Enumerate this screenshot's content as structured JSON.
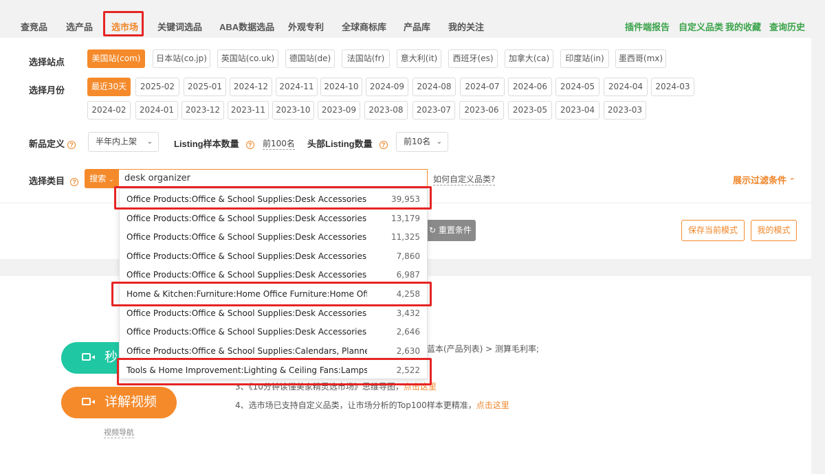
{
  "nav": {
    "tabs": [
      "查竞品",
      "选产品",
      "选市场",
      "关键词选品",
      "ABA数据选品",
      "外观专利",
      "全球商标库",
      "产品库",
      "我的关注"
    ],
    "active_tab": "选市场",
    "right_links": [
      "插件端报告",
      "自定义品类",
      "我的收藏",
      "查询历史"
    ]
  },
  "filters": {
    "site_label": "选择站点",
    "sites": [
      "美国站(com)",
      "日本站(co.jp)",
      "英国站(co.uk)",
      "德国站(de)",
      "法国站(fr)",
      "意大利(it)",
      "西班牙(es)",
      "加拿大(ca)",
      "印度站(in)",
      "墨西哥(mx)"
    ],
    "selected_site": "美国站(com)",
    "month_label": "选择月份",
    "months_row1": [
      "最近30天",
      "2025-02",
      "2025-01",
      "2024-12",
      "2024-11",
      "2024-10",
      "2024-09",
      "2024-08",
      "2024-07",
      "2024-06",
      "2024-05",
      "2024-04",
      "2024-03"
    ],
    "months_row2": [
      "2024-02",
      "2024-01",
      "2023-12",
      "2023-11",
      "2023-10",
      "2023-09",
      "2023-08",
      "2023-07",
      "2023-06",
      "2023-05",
      "2023-04",
      "2023-03"
    ],
    "selected_month": "最近30天",
    "new_def_label": "新品定义",
    "new_def_value": "半年内上架",
    "listing_sample_label": "Listing样本数量",
    "listing_sample_value": "前100名",
    "top_listing_label": "头部Listing数量",
    "top_listing_value": "前10名",
    "category_label": "选择类目",
    "search_btn": "搜索",
    "search_value": "desk organizer",
    "howto": "如何自定义品类?",
    "expand": "展示过滤条件"
  },
  "actions": {
    "reset": "重置条件",
    "save_mode": "保存当前模式",
    "my_mode": "我的模式"
  },
  "dropdown": [
    {
      "name": "Office Products:Office & School Supplies:Desk Accessories &...",
      "count": "39,953",
      "highlighted": true
    },
    {
      "name": "Office Products:Office & School Supplies:Desk Accessories &...",
      "count": "13,179",
      "highlighted": false
    },
    {
      "name": "Office Products:Office & School Supplies:Desk Accessories &...",
      "count": "11,325",
      "highlighted": false
    },
    {
      "name": "Office Products:Office & School Supplies:Desk Accessories &...",
      "count": "7,860",
      "highlighted": false
    },
    {
      "name": "Office Products:Office & School Supplies:Desk Accessories &...",
      "count": "6,987",
      "highlighted": false
    },
    {
      "name": "Home & Kitchen:Furniture:Home Office Furniture:Home Offic...",
      "count": "4,258",
      "highlighted": true
    },
    {
      "name": "Office Products:Office & School Supplies:Desk Accessories &...",
      "count": "3,432",
      "highlighted": false
    },
    {
      "name": "Office Products:Office & School Supplies:Desk Accessories &...",
      "count": "2,646",
      "highlighted": false
    },
    {
      "name": "Office Products:Office & School Supplies:Calendars, Planners...",
      "count": "2,630",
      "highlighted": false
    },
    {
      "name": "Tools & Home Improvement:Lighting & Ceiling Fans:Lamps ...",
      "count": "2,522",
      "highlighted": true
    }
  ],
  "lower": {
    "video1": "秒",
    "video2": "详解视频",
    "video_nav": "视频导航",
    "tip2_tail": "蓝本(产品列表) > 测算毛利率;",
    "tip3": "3、《10分钟读懂美家精灵选市场》思维导图，",
    "tip3_link": "点击这里",
    "tip4": "4、选市场已支持自定义品类，让市场分析的Top100样本更精准，",
    "tip4_link": "点击这里"
  },
  "colors": {
    "accent": "#f58a2b",
    "green": "#3aa34a",
    "teal": "#1fc7a3",
    "highlight": "#e62424"
  }
}
